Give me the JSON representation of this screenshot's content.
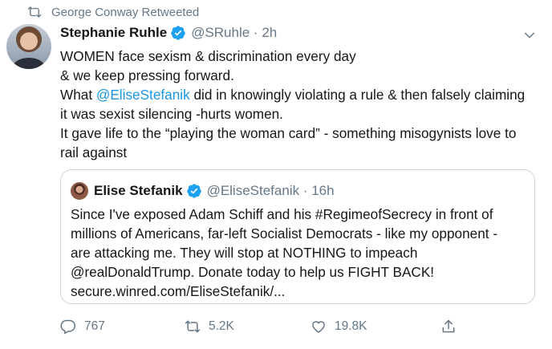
{
  "retweet_context": {
    "text": "George Conway Retweeted",
    "icon": "retweet-icon"
  },
  "tweet": {
    "display_name": "Stephanie Ruhle",
    "handle": "@SRuhle",
    "separator": " · ",
    "time": "2h",
    "lines": [
      "WOMEN face sexism & discrimination every  day",
      "& we keep pressing forward."
    ],
    "line3_prefix": "What ",
    "line3_mention": "@EliseStefanik",
    "line3_suffix": " did in knowingly violating a rule & then falsely claiming",
    "line4": "it was sexist silencing -hurts women.",
    "line5": "It gave life to the “playing the woman card” - something misogynists love to",
    "line6": "rail against"
  },
  "quote": {
    "display_name": "Elise Stefanik",
    "handle": "@EliseStefanik",
    "separator": " · ",
    "time": "16h",
    "lines": [
      "Since I've exposed Adam Schiff and his #RegimeofSecrecy in front of",
      "millions of Americans, far-left Socialist Democrats - like my opponent -",
      "are attacking me. They will stop at NOTHING to impeach",
      "@realDonaldTrump. Donate today to help us FIGHT BACK!",
      "secure.winred.com/EliseStefanik/..."
    ]
  },
  "actions": {
    "replies": "767",
    "retweets": "5.2K",
    "likes": "19.8K"
  },
  "colors": {
    "accent": "#1da1f2",
    "link": "#1b95e0",
    "muted": "#657786",
    "border": "#ccd6dd"
  }
}
